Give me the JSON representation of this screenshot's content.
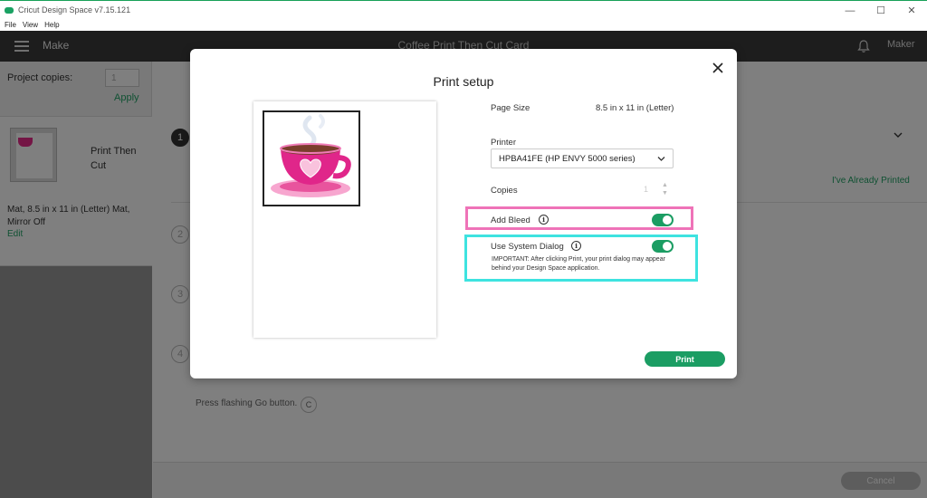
{
  "window": {
    "title": "Cricut Design Space  v7.15.121",
    "controls": {
      "minimize": "—",
      "maximize": "☐",
      "close": "✕"
    }
  },
  "menu": [
    "File",
    "View",
    "Help"
  ],
  "header": {
    "section": "Make",
    "project_name": "Coffee Print Then Cut Card",
    "user": "Maker"
  },
  "sidebar": {
    "copies_label": "Project copies:",
    "copies_value": "1",
    "apply_label": "Apply",
    "mat": {
      "title": "Print Then Cut",
      "description": "Mat, 8.5 in x 11 in (Letter) Mat, Mirror Off",
      "edit_label": "Edit"
    }
  },
  "main": {
    "steps": [
      "1",
      "2",
      "3",
      "4"
    ],
    "already_printed": "I've Already Printed",
    "press_go": "Press flashing Go button.",
    "go_glyph": "C",
    "cancel_label": "Cancel"
  },
  "modal": {
    "title": "Print setup",
    "page_size_label": "Page Size",
    "page_size_value": "8.5 in x 11 in (Letter)",
    "printer_label": "Printer",
    "printer_value": "HPBA41FE (HP ENVY 5000 series)",
    "copies_label": "Copies",
    "copies_value": "1",
    "add_bleed_label": "Add Bleed",
    "add_bleed_on": true,
    "system_dialog_label": "Use System Dialog",
    "system_dialog_on": true,
    "important_note": "IMPORTANT: After clicking Print, your print dialog may appear behind your Design Space application.",
    "print_label": "Print",
    "info_glyph": "i"
  },
  "colors": {
    "accent": "#1b9d63",
    "highlight_pink": "#ef73b8",
    "highlight_cyan": "#3ee3e0",
    "header_bg": "#3b3b3b"
  }
}
